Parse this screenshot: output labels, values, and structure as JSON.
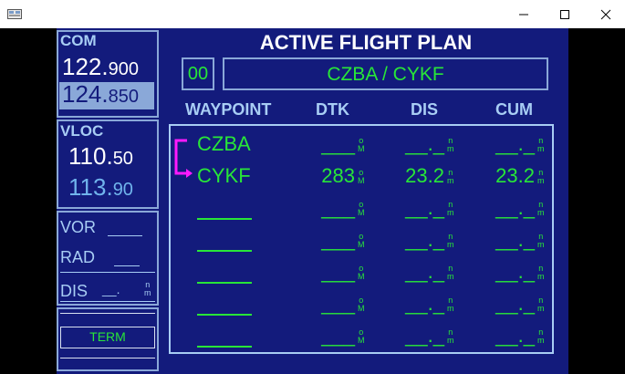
{
  "window": {
    "controls": {
      "minimize": "minimize-icon",
      "maximize": "maximize-icon",
      "close": "close-icon"
    }
  },
  "com": {
    "label": "COM",
    "active_main": "122.",
    "active_dec": "900",
    "standby_main": "124.",
    "standby_dec": "850"
  },
  "vloc": {
    "label": "VLOC",
    "active_main": "110.",
    "active_dec": "50",
    "standby_main": "113.",
    "standby_dec": "90"
  },
  "vor": {
    "vor_label": "VOR",
    "rad_label": "RAD",
    "dis_label": "DIS",
    "dis_value": "__.",
    "dis_unit": "n\nm"
  },
  "term": {
    "label": "TERM"
  },
  "flight_plan": {
    "title": "ACTIVE FLIGHT PLAN",
    "number": "00",
    "name": "CZBA / CYKF",
    "headers": {
      "waypoint": "WAYPOINT",
      "dtk": "DTK",
      "dis": "DIS",
      "cum": "CUM"
    },
    "rows": [
      {
        "waypoint": "CZBA",
        "dtk": "___",
        "dis": "__._",
        "cum": "__._"
      },
      {
        "waypoint": "CYKF",
        "dtk": "283",
        "dis": "23.2",
        "cum": "23.2"
      },
      {
        "waypoint": "",
        "dtk": "___",
        "dis": "__._",
        "cum": "__._"
      },
      {
        "waypoint": "",
        "dtk": "___",
        "dis": "__._",
        "cum": "__._"
      },
      {
        "waypoint": "",
        "dtk": "___",
        "dis": "__._",
        "cum": "__._"
      },
      {
        "waypoint": "",
        "dtk": "___",
        "dis": "__._",
        "cum": "__._"
      },
      {
        "waypoint": "",
        "dtk": "___",
        "dis": "__._",
        "cum": "__._"
      }
    ],
    "dtk_unit": "o\nM",
    "dist_unit": "n\nm"
  },
  "colors": {
    "screen_bg": "#131b7c",
    "accent_green": "#28e638",
    "label_blue": "#a8cdf4",
    "active_leg_magenta": "#ff1aff"
  }
}
